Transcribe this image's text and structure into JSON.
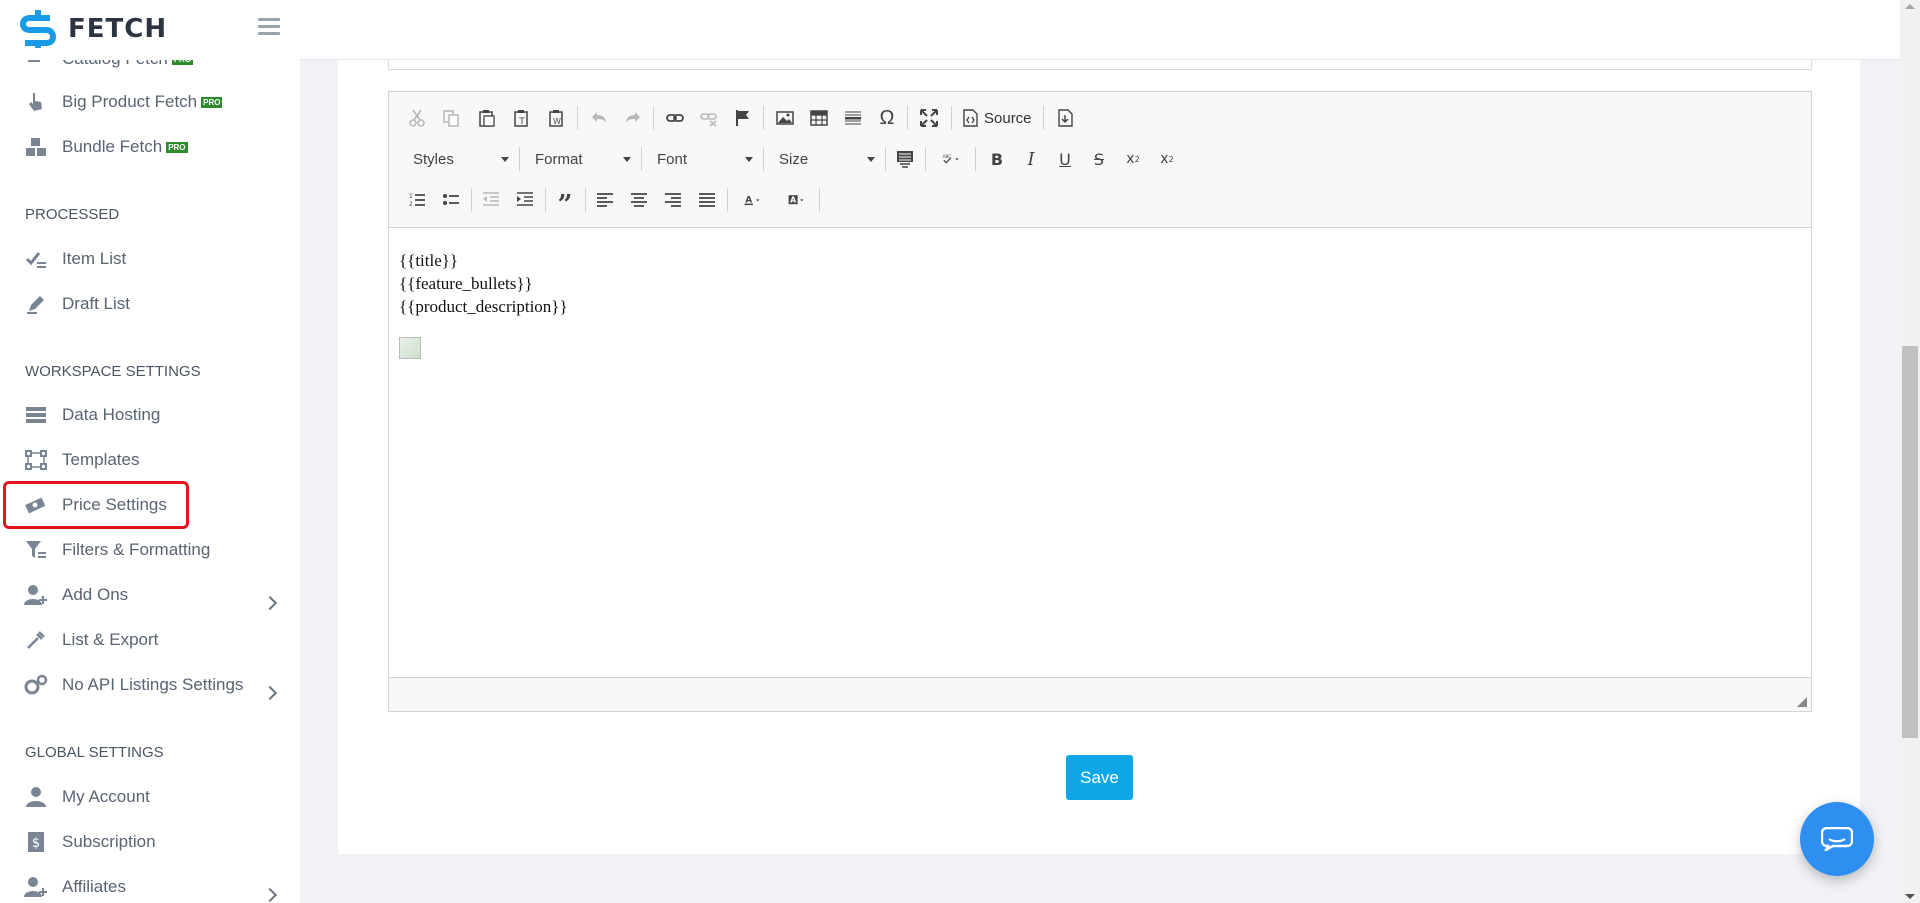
{
  "app": {
    "brand_name": "FETCH"
  },
  "sidebar": {
    "items_top": [
      {
        "label": "Catalog Fetch",
        "badge": "PRO"
      },
      {
        "label": "Big Product Fetch",
        "badge": "PRO"
      },
      {
        "label": "Bundle Fetch",
        "badge": "PRO"
      }
    ],
    "sections": {
      "processed": "PROCESSED",
      "workspace": "WORKSPACE SETTINGS",
      "global": "GLOBAL SETTINGS"
    },
    "processed_items": [
      {
        "label": "Item List"
      },
      {
        "label": "Draft List"
      }
    ],
    "workspace_items": [
      {
        "label": "Data Hosting"
      },
      {
        "label": "Templates"
      },
      {
        "label": "Price Settings"
      },
      {
        "label": "Filters & Formatting"
      },
      {
        "label": "Add Ons"
      },
      {
        "label": "List & Export"
      },
      {
        "label": "No API Listings Settings"
      }
    ],
    "global_items": [
      {
        "label": "My Account"
      },
      {
        "label": "Subscription"
      },
      {
        "label": "Affiliates"
      }
    ]
  },
  "editor": {
    "source_label": "Source",
    "combos": {
      "styles": "Styles",
      "format": "Format",
      "font": "Font",
      "size": "Size"
    },
    "content_lines": [
      "{{title}}",
      "{{feature_bullets}}",
      "{{product_description}}"
    ]
  },
  "actions": {
    "save_label": "Save"
  },
  "colors": {
    "accent": "#10a7e8",
    "highlight": "#e3141b",
    "brand": "#1a9be6",
    "chat": "#2f8ff0"
  }
}
